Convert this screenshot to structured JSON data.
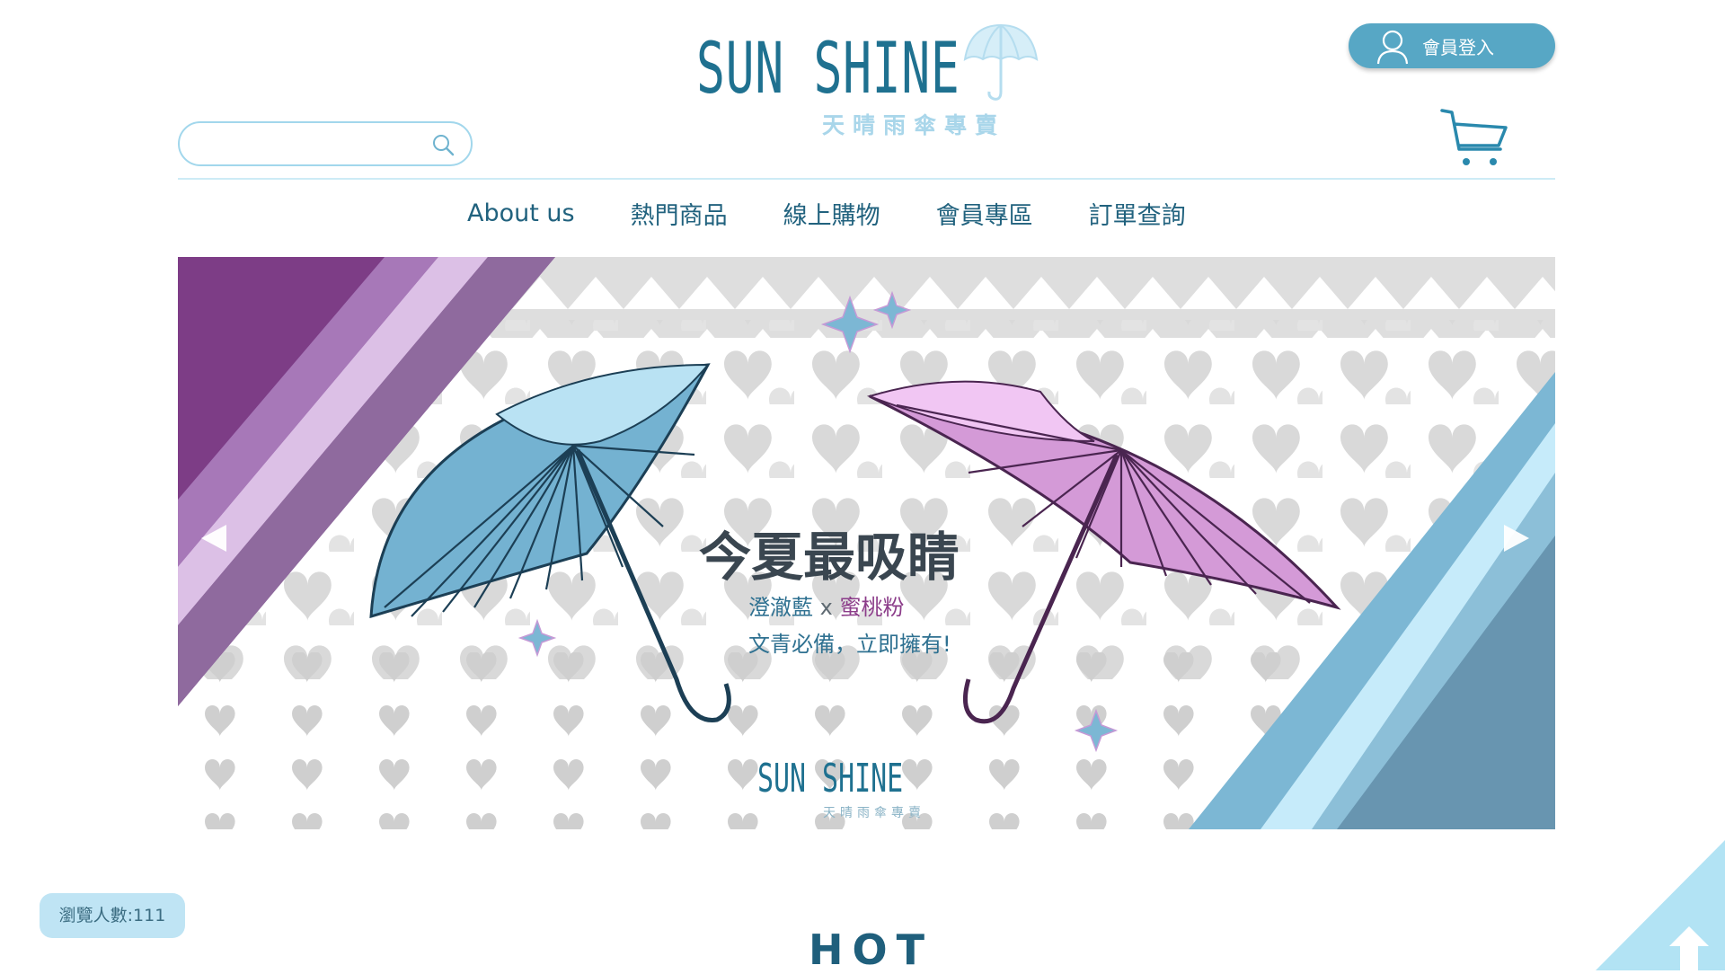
{
  "brand": {
    "name": "SUN SHINE",
    "subtitle": "天晴雨傘專賣"
  },
  "header": {
    "login_label": "會員登入",
    "search": {
      "value": "",
      "placeholder": ""
    }
  },
  "nav": {
    "items": [
      {
        "label": "About us"
      },
      {
        "label": "熱門商品"
      },
      {
        "label": "線上購物"
      },
      {
        "label": "會員專區"
      },
      {
        "label": "訂單查詢"
      }
    ]
  },
  "banner": {
    "headline": "今夏最吸睛",
    "sub_blue": "澄澈藍",
    "sub_x": " x ",
    "sub_pink": "蜜桃粉",
    "tagline": "文青必備，立即擁有!",
    "logo_text": "SUN SHINE",
    "logo_sub": "天晴雨傘專賣"
  },
  "footer": {
    "visitor_label": "瀏覽人數:111",
    "hot_title": "HOT"
  },
  "icons": {
    "search": "search-icon",
    "cart": "cart-icon",
    "user": "user-icon",
    "prev": "chevron-left-icon",
    "next": "chevron-right-icon",
    "back_to_top": "arrow-up-icon"
  },
  "colors": {
    "brand_blue": "#1f7190",
    "nav_text": "#21627e",
    "login_button": "#57a7c5",
    "accent_light": "#a2d7ec",
    "purple": "#7d3d86",
    "umbrella_blue": "#74b2d1",
    "umbrella_pink": "#d49ad7"
  }
}
